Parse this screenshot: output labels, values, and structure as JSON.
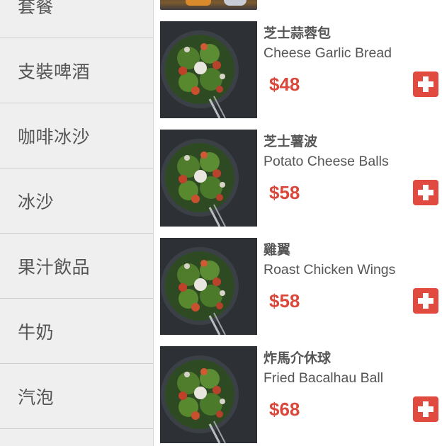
{
  "categories": [
    {
      "label": "套餐"
    },
    {
      "label": "支裝啤酒"
    },
    {
      "label": "咖啡冰沙"
    },
    {
      "label": "冰沙"
    },
    {
      "label": "果汁飲品"
    },
    {
      "label": "牛奶"
    },
    {
      "label": "汽泡"
    }
  ],
  "products": [
    {
      "name_zh": "芝士蒜蓉包",
      "name_en": "Cheese Garlic Bread",
      "price": "$48",
      "image": "salad-bowl-image"
    },
    {
      "name_zh": "芝士薯波",
      "name_en": "Potato Cheese Balls",
      "price": "$58",
      "image": "salad-bowl-image"
    },
    {
      "name_zh": "雞翼",
      "name_en": "Roast Chicken Wings",
      "price": "$58",
      "image": "salad-bowl-image"
    },
    {
      "name_zh": "炸馬介休球",
      "name_en": "Fried Bacalhau Ball",
      "price": "$68",
      "image": "salad-bowl-image"
    }
  ],
  "colors": {
    "sidebar_bg": "#efefef",
    "price": "#d9483b",
    "add_button": "#e04a3f",
    "text": "#555555"
  },
  "icons": {
    "add": "plus-icon"
  }
}
